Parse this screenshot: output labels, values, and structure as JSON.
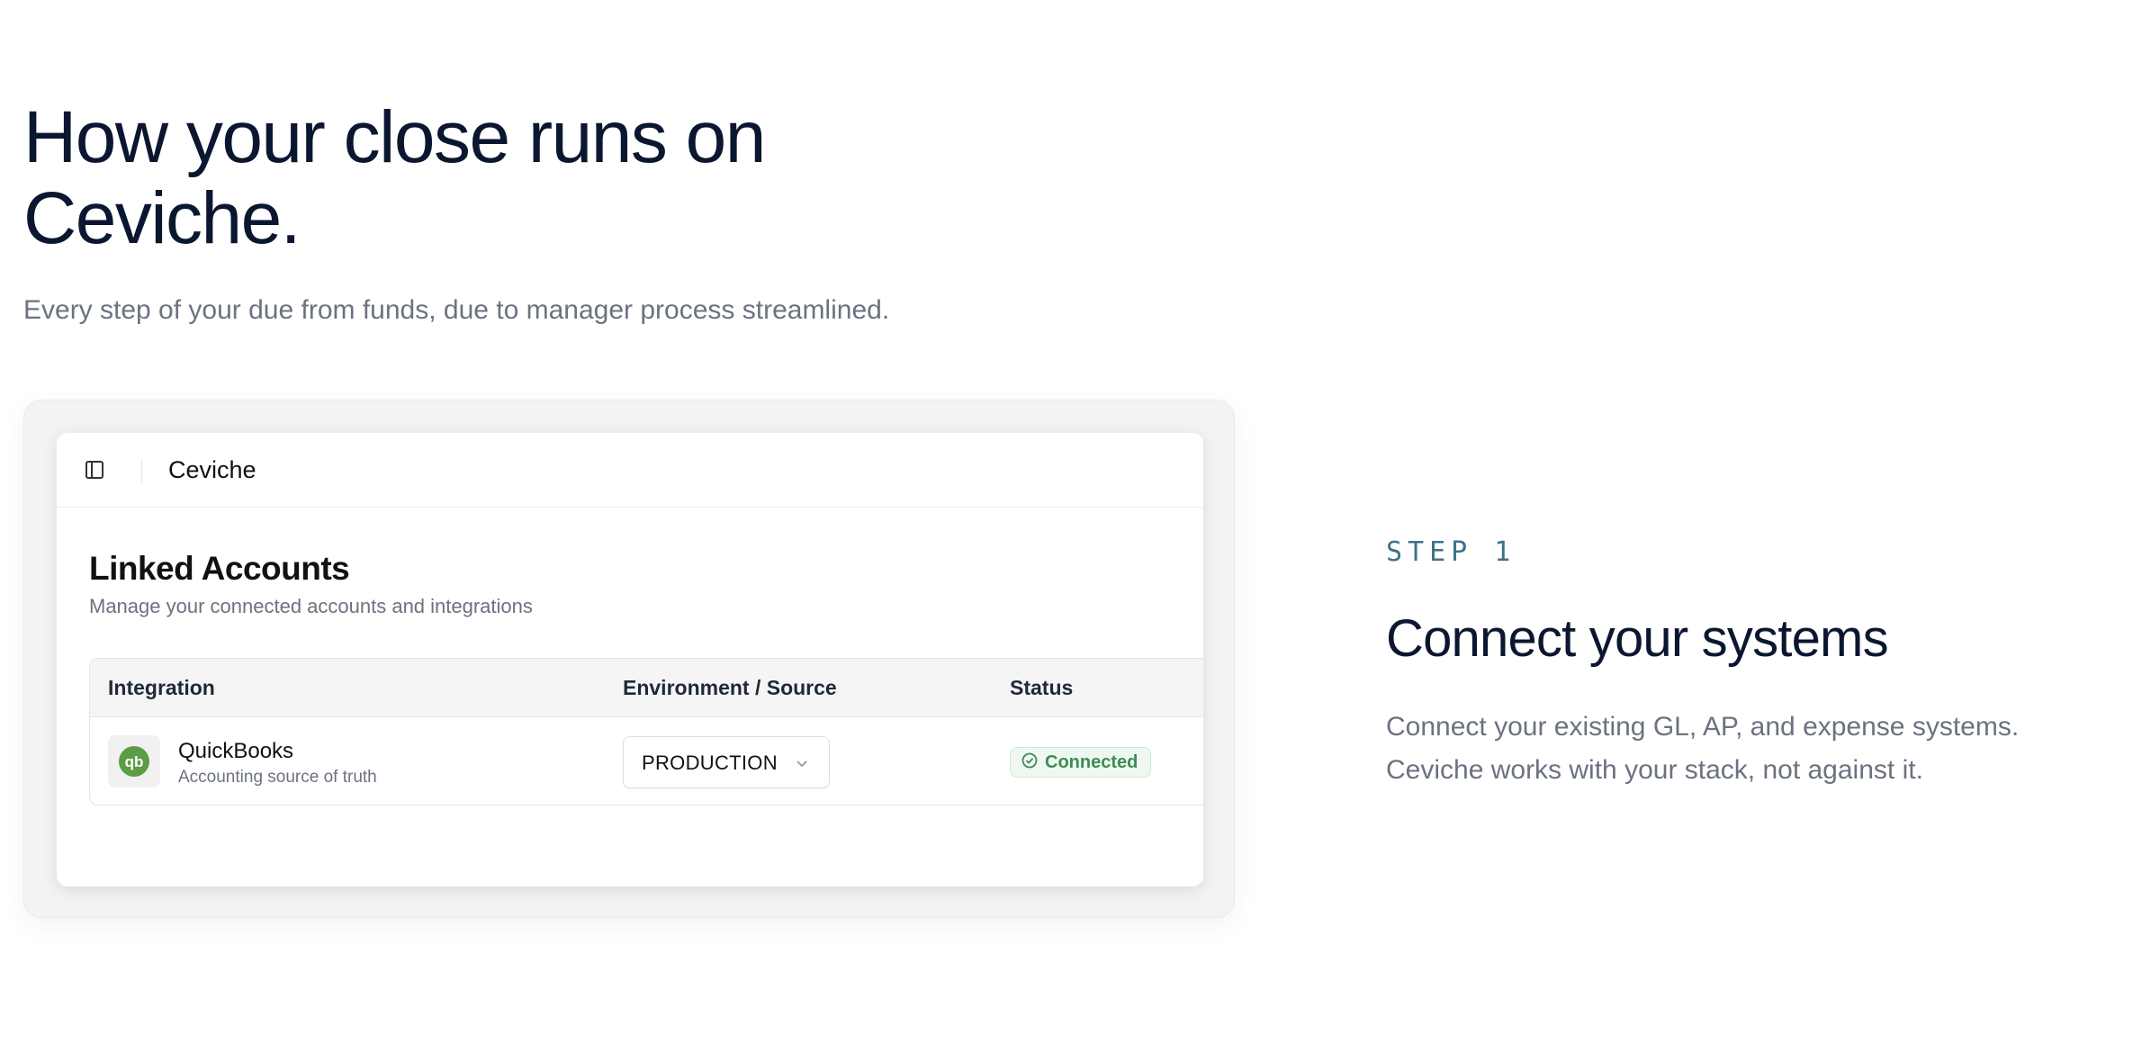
{
  "hero": {
    "title": "How your close runs on Ceviche.",
    "subtitle": "Every step of your due from funds, due to manager process streamlined."
  },
  "app": {
    "name": "Ceviche",
    "panel": {
      "title": "Linked Accounts",
      "subtitle": "Manage your connected accounts and integrations"
    },
    "table": {
      "headers": [
        "Integration",
        "Environment / Source",
        "Status"
      ],
      "rows": [
        {
          "name": "QuickBooks",
          "description": "Accounting source of truth",
          "logo_text": "qb",
          "logo_icon": "quickbooks-logo-icon",
          "environment": "PRODUCTION",
          "status": "Connected"
        }
      ]
    }
  },
  "step": {
    "label": "STEP 1",
    "title": "Connect your systems",
    "description": "Connect your existing GL, AP, and expense systems. Ceviche works with your stack, not against it."
  },
  "colors": {
    "heading": "#0b1730",
    "muted": "#6b7280",
    "step_accent": "#3e7289",
    "quickbooks_green": "#5d9c47",
    "status_green": "#3f8a55"
  }
}
